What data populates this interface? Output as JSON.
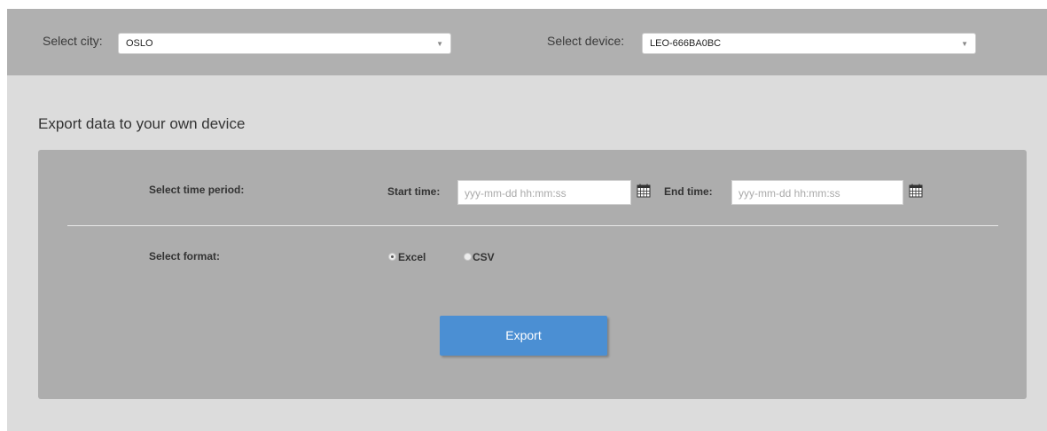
{
  "header": {
    "city_label": "Select city:",
    "city_value": "OSLO",
    "device_label": "Select device:",
    "device_value": "LEO-666BA0BC",
    "dropdown_icon": "chevron-down-icon"
  },
  "export_section": {
    "title": "Export data to your own device",
    "time_period_label": "Select time period:",
    "start_time_label": "Start time:",
    "start_time_placeholder": "yyy-mm-dd hh:mm:ss",
    "end_time_label": "End time:",
    "end_time_placeholder": "yyy-mm-dd hh:mm:ss",
    "calendar_icon": "calendar-icon",
    "format_label": "Select format:",
    "format_options": [
      {
        "label": "Excel",
        "selected": true
      },
      {
        "label": "CSV",
        "selected": false
      }
    ],
    "export_button": "Export"
  },
  "colors": {
    "top_bar": "#b0b0b0",
    "content_bg": "#dcdcdc",
    "panel_bg": "#adadad",
    "button": "#4b8fd3"
  }
}
